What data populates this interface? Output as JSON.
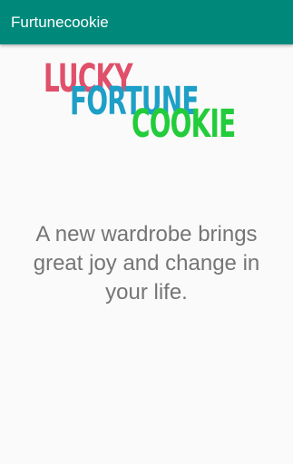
{
  "app_bar": {
    "title": "Furtunecookie",
    "background_color": "#00897b",
    "title_color": "#ffffff"
  },
  "logo": {
    "words": [
      {
        "text": "LUCKY",
        "color": "#e0506a"
      },
      {
        "text": "FORTUNE",
        "color": "#1e9fc7"
      },
      {
        "text": "COOKIE",
        "color": "#22cc3a"
      }
    ]
  },
  "fortune": {
    "text": "A new wardrobe brings great joy and change in your life.",
    "color": "#757575"
  },
  "page": {
    "background_color": "#fafafa"
  }
}
